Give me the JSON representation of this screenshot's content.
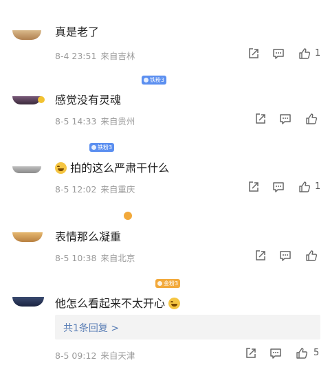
{
  "comments": [
    {
      "text": "真是老了",
      "date": "8-4 23:51",
      "location": "来自吉林",
      "likes": "1",
      "badge": null
    },
    {
      "text": "感觉没有灵魂",
      "date": "8-5 14:33",
      "location": "来自贵州",
      "likes": "",
      "badge": "铁粉3"
    },
    {
      "text": "拍的这么严肃干什么",
      "date": "8-5 12:02",
      "location": "来自重庆",
      "likes": "1",
      "badge": "铁粉3"
    },
    {
      "text": "表情那么凝重",
      "date": "8-5 10:38",
      "location": "来自北京",
      "likes": "",
      "badge": null
    },
    {
      "text": "他怎么看起来不太开心",
      "date": "8-5 09:12",
      "location": "来自天津",
      "likes": "5",
      "badge": "金粉3",
      "reply_summary": "共1条回复 >"
    }
  ],
  "icons": {
    "share": "share-icon",
    "comment": "comment-icon",
    "like": "thumbs-up-icon",
    "emoji_laugh": "laughing-tears-emoji",
    "emoji_grin": "grinning-emoji"
  },
  "colors": {
    "badge_blue": "#5b8ff0",
    "badge_gold": "#f2a93b",
    "reply_link": "#5b7fb6",
    "meta_gray": "#9a9a9a"
  }
}
